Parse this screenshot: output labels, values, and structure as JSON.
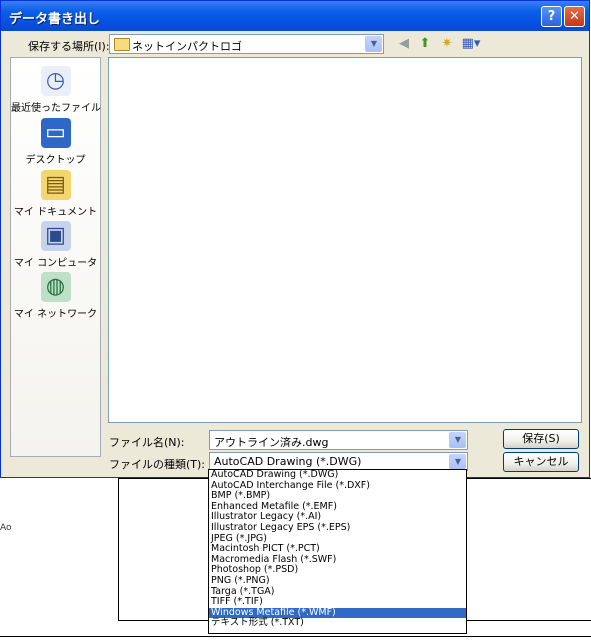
{
  "dialog": {
    "title": "データ書き出し",
    "help_glyph": "?",
    "close_glyph": "✕"
  },
  "location": {
    "label": "保存する場所(I):",
    "value": "ネットインパクトロゴ"
  },
  "toolbar": {
    "icons": [
      "back-icon",
      "up-folder-icon",
      "new-folder-icon",
      "view-menu-icon"
    ]
  },
  "places": [
    {
      "label": "最近使ったファイル",
      "icon": "recent-files-icon"
    },
    {
      "label": "デスクトップ",
      "icon": "desktop-icon"
    },
    {
      "label": "マイ ドキュメント",
      "icon": "my-documents-icon"
    },
    {
      "label": "マイ コンピュータ",
      "icon": "my-computer-icon"
    },
    {
      "label": "マイ ネットワーク",
      "icon": "my-network-icon"
    }
  ],
  "filename": {
    "label": "ファイル名(N):",
    "value": "アウトライン済み.dwg"
  },
  "filetype": {
    "label": "ファイルの種類(T):",
    "value": "AutoCAD Drawing (*.DWG)",
    "options": [
      "AutoCAD Drawing (*.DWG)",
      "AutoCAD Interchange File (*.DXF)",
      "BMP (*.BMP)",
      "Enhanced Metafile (*.EMF)",
      "Illustrator Legacy (*.AI)",
      "Illustrator Legacy EPS (*.EPS)",
      "JPEG (*.JPG)",
      "Macintosh PICT (*.PCT)",
      "Macromedia Flash (*.SWF)",
      "Photoshop (*.PSD)",
      "PNG (*.PNG)",
      "Targa (*.TGA)",
      "TIFF (*.TIF)",
      "Windows Metafile (*.WMF)",
      "テキスト形式 (*.TXT)"
    ],
    "highlighted": "Windows Metafile (*.WMF)"
  },
  "buttons": {
    "save": "保存(S)",
    "cancel": "キャンセル"
  },
  "background": {
    "edge_glyph": "Ao"
  }
}
